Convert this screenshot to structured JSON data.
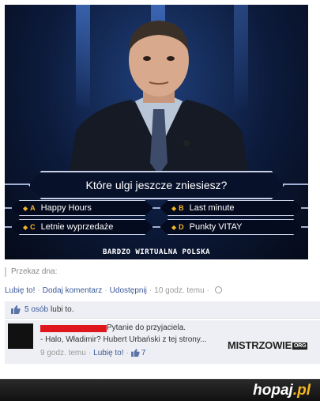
{
  "meme": {
    "question": "Które ulgi jeszcze zniesiesz?",
    "answers": [
      {
        "letter": "A",
        "text": "Happy Hours"
      },
      {
        "letter": "B",
        "text": "Last minute"
      },
      {
        "letter": "C",
        "text": "Letnie wyprzedaże"
      },
      {
        "letter": "D",
        "text": "Punkty VITAY"
      }
    ],
    "caption": "BARDZO WIRTUALNA POLSKA"
  },
  "post": {
    "share_label": "Przekaz dna:",
    "actions": {
      "like": "Lubię to!",
      "comment": "Dodaj komentarz",
      "share": "Udostępnij",
      "time": "10 godz. temu"
    },
    "likes": {
      "count_link": "5 osób",
      "suffix": "lubi to."
    }
  },
  "comment": {
    "line1": "Pytanie do przyjaciela.",
    "line2": "- Halo, Władimir? Hubert Urbański z tej strony...",
    "time": "9 godz. temu",
    "like": "Lubię to!",
    "like_count": "7"
  },
  "watermark": {
    "name": "MISTRZOWIE",
    "org": "ORG"
  },
  "footer": {
    "logo_main": "hopaj",
    "logo_tld": ".pl"
  },
  "colors": {
    "fb_link": "#3b5998",
    "fb_bg": "#edeff4",
    "answer_accent": "#f5b623",
    "censor_red": "#e0161e"
  }
}
